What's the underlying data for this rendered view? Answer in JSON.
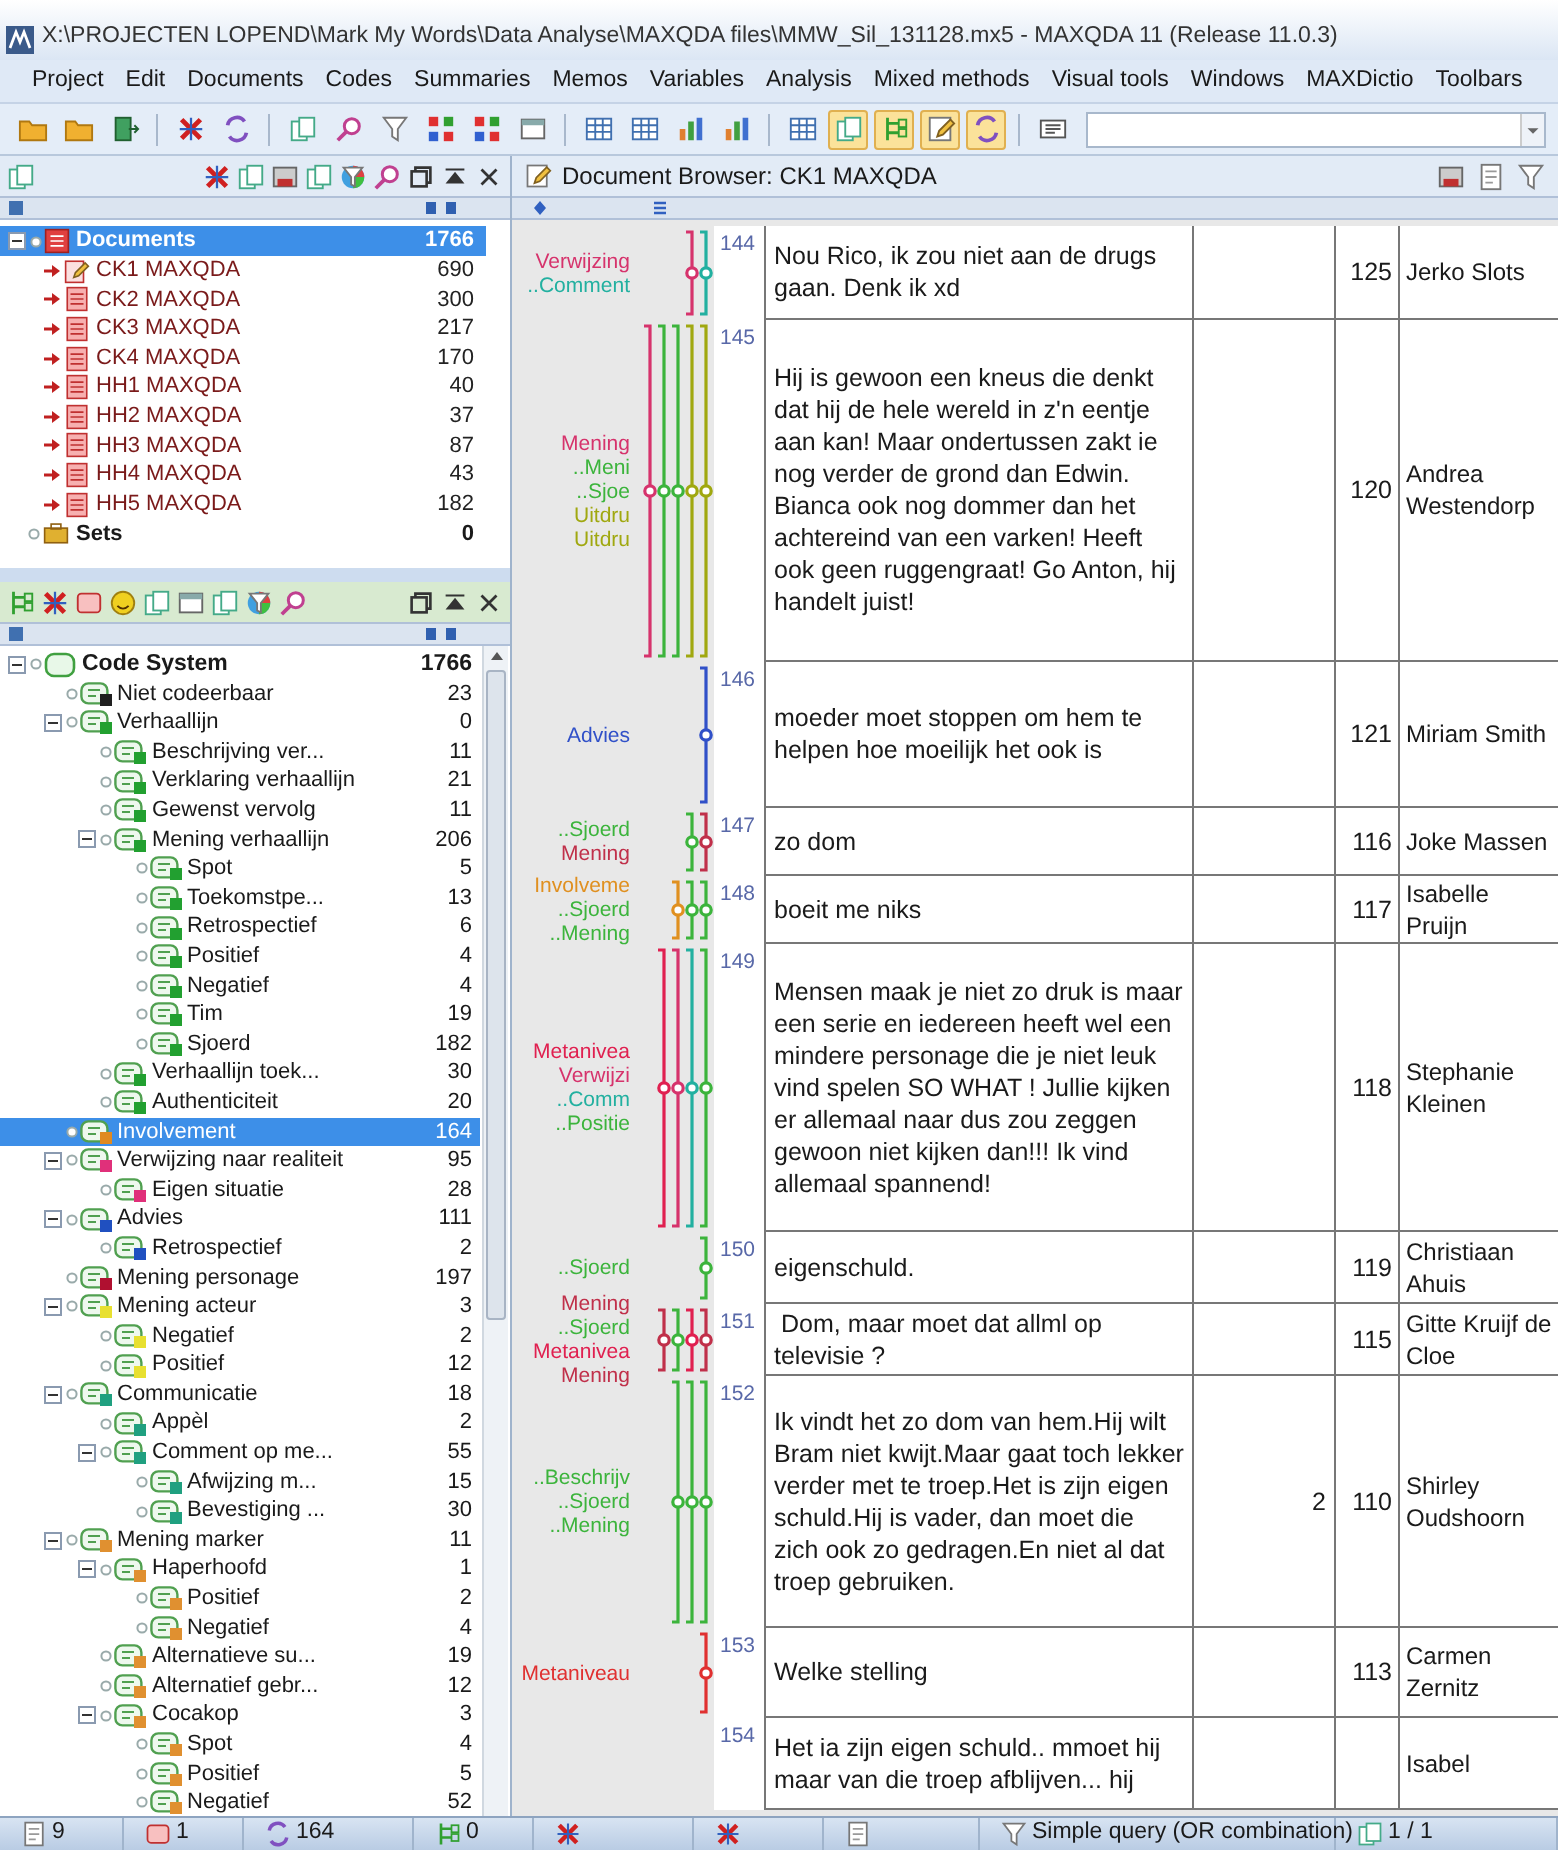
{
  "window": {
    "title": "X:\\PROJECTEN LOPEND\\Mark My Words\\Data Analyse\\MAXQDA files\\MMW_Sil_131128.mx5 - MAXQDA 11  (Release 11.0.3)"
  },
  "menu": [
    {
      "label": "Project"
    },
    {
      "label": "Edit"
    },
    {
      "label": "Documents"
    },
    {
      "label": "Codes"
    },
    {
      "label": "Summaries"
    },
    {
      "label": "Memos"
    },
    {
      "label": "Variables"
    },
    {
      "label": "Analysis"
    },
    {
      "label": "Mixed methods"
    },
    {
      "label": "Visual tools"
    },
    {
      "label": "Windows"
    },
    {
      "label": "MAXDictio"
    },
    {
      "label": "Toolbars"
    }
  ],
  "toolbar": [
    {
      "on": false
    },
    {
      "on": false
    },
    {
      "on": false
    },
    {
      "on": false
    },
    {
      "on": false
    },
    {
      "on": false
    },
    {
      "on": false
    },
    {
      "on": false
    },
    {
      "on": false
    },
    {
      "on": false
    },
    {
      "on": false
    },
    {
      "on": false
    },
    {
      "on": false
    },
    {
      "on": false
    },
    {
      "on": false
    },
    {
      "on": false
    },
    {
      "on": true
    },
    {
      "on": true
    },
    {
      "on": true
    },
    {
      "on": true
    },
    {
      "on": false
    }
  ],
  "document_system": {
    "root": {
      "label": "Documents",
      "count": "1766",
      "selected": true,
      "expanded": true
    },
    "documents": [
      {
        "label": "CK1 MAXQDA",
        "count": "690",
        "kind": "open"
      },
      {
        "label": "CK2 MAXQDA",
        "count": "300",
        "kind": "text"
      },
      {
        "label": "CK3 MAXQDA",
        "count": "217",
        "kind": "text"
      },
      {
        "label": "CK4 MAXQDA",
        "count": "170",
        "kind": "text"
      },
      {
        "label": "HH1 MAXQDA",
        "count": "40",
        "kind": "text"
      },
      {
        "label": "HH2 MAXQDA",
        "count": "37",
        "kind": "text"
      },
      {
        "label": "HH3 MAXQDA",
        "count": "87",
        "kind": "text"
      },
      {
        "label": "HH4 MAXQDA",
        "count": "43",
        "kind": "text"
      },
      {
        "label": "HH5 MAXQDA",
        "count": "182",
        "kind": "text"
      }
    ],
    "sets": {
      "label": "Sets",
      "count": "0"
    }
  },
  "code_system": {
    "label": "Code System",
    "count": "1766",
    "expanded": true,
    "children": [
      {
        "label": "Niet codeerbaar",
        "count": "23",
        "color": "#202020",
        "selected": false
      },
      {
        "label": "Verhaallijn",
        "count": "0",
        "color": "#22a030",
        "selected": false,
        "expanded": true,
        "children": [
          {
            "label": "Beschrijving ver...",
            "count": "11",
            "color": "#22a030",
            "selected": false
          },
          {
            "label": "Verklaring verhaallijn",
            "count": "21",
            "color": "#22a030",
            "selected": false
          },
          {
            "label": "Gewenst vervolg",
            "count": "11",
            "color": "#22a030",
            "selected": false
          },
          {
            "label": "Mening verhaallijn",
            "count": "206",
            "color": "#22a030",
            "selected": false,
            "expanded": true,
            "children": [
              {
                "label": "Spot",
                "count": "5",
                "color": "#22a030",
                "selected": false
              },
              {
                "label": "Toekomstpe...",
                "count": "13",
                "color": "#22a030",
                "selected": false
              },
              {
                "label": "Retrospectief",
                "count": "6",
                "color": "#22a030",
                "selected": false
              },
              {
                "label": "Positief",
                "count": "4",
                "color": "#22a030",
                "selected": false
              },
              {
                "label": "Negatief",
                "count": "4",
                "color": "#22a030",
                "selected": false
              },
              {
                "label": "Tim",
                "count": "19",
                "color": "#22a030",
                "selected": false
              },
              {
                "label": "Sjoerd",
                "count": "182",
                "color": "#22a030",
                "selected": false
              }
            ]
          },
          {
            "label": "Verhaallijn toek...",
            "count": "30",
            "color": "#22a030",
            "selected": false
          },
          {
            "label": "Authenticiteit",
            "count": "20",
            "color": "#22a030",
            "selected": false
          }
        ]
      },
      {
        "label": "Involvement",
        "count": "164",
        "color": "#e08a20",
        "selected": true
      },
      {
        "label": "Verwijzing naar realiteit",
        "count": "95",
        "color": "#e0307a",
        "selected": false,
        "expanded": true,
        "children": [
          {
            "label": "Eigen situatie",
            "count": "28",
            "color": "#e0307a",
            "selected": false
          }
        ]
      },
      {
        "label": "Advies",
        "count": "111",
        "color": "#2050c0",
        "selected": false,
        "expanded": true,
        "children": [
          {
            "label": "Retrospectief",
            "count": "2",
            "color": "#2050c0",
            "selected": false
          }
        ]
      },
      {
        "label": "Mening personage",
        "count": "197",
        "color": "#b01030",
        "selected": false
      },
      {
        "label": "Mening acteur",
        "count": "3",
        "color": "#e8e030",
        "selected": false,
        "expanded": true,
        "children": [
          {
            "label": "Negatief",
            "count": "2",
            "color": "#e8e030",
            "selected": false
          },
          {
            "label": "Positief",
            "count": "12",
            "color": "#e8e030",
            "selected": false
          }
        ]
      },
      {
        "label": "Communicatie",
        "count": "18",
        "color": "#20a080",
        "selected": false,
        "expanded": true,
        "children": [
          {
            "label": "Appèl",
            "count": "2",
            "color": "#20a080",
            "selected": false
          },
          {
            "label": "Comment op me...",
            "count": "55",
            "color": "#20a080",
            "selected": false,
            "expanded": true,
            "children": [
              {
                "label": "Afwijzing m...",
                "count": "15",
                "color": "#20a080",
                "selected": false
              },
              {
                "label": "Bevestiging ...",
                "count": "30",
                "color": "#20a080",
                "selected": false
              }
            ]
          }
        ]
      },
      {
        "label": "Mening marker",
        "count": "11",
        "color": "#e09030",
        "selected": false,
        "expanded": true,
        "children": [
          {
            "label": "Haperhoofd",
            "count": "1",
            "color": "#e09030",
            "selected": false,
            "expanded": true,
            "children": [
              {
                "label": "Positief",
                "count": "2",
                "color": "#e09030",
                "selected": false
              },
              {
                "label": "Negatief",
                "count": "4",
                "color": "#e09030",
                "selected": false
              }
            ]
          },
          {
            "label": "Alternatieve su...",
            "count": "19",
            "color": "#e09030",
            "selected": false
          },
          {
            "label": "Alternatief gebr...",
            "count": "12",
            "color": "#e09030",
            "selected": false
          },
          {
            "label": "Cocakop",
            "count": "3",
            "color": "#e09030",
            "selected": false,
            "expanded": true,
            "children": [
              {
                "label": "Spot",
                "count": "4",
                "color": "#e09030",
                "selected": false
              },
              {
                "label": "Positief",
                "count": "5",
                "color": "#e09030",
                "selected": false
              },
              {
                "label": "Negatief",
                "count": "52",
                "color": "#e09030",
                "selected": false
              }
            ]
          }
        ]
      }
    ]
  },
  "document_browser": {
    "title": "Document Browser: CK1 MAXQDA",
    "rows": [
      {
        "paragraph": "144",
        "codes": [
          {
            "label": "Verwijzing",
            "color": "#d6336c"
          },
          {
            "label": "..Comment",
            "color": "#22b0a0"
          }
        ],
        "text": "Nou Rico, ik zou niet aan de drugs gaan. Denk ik xd",
        "column_3": "125",
        "column_4": "Jerko Slots"
      },
      {
        "paragraph": "145",
        "codes": [
          {
            "label": "Mening",
            "color": "#d6336c"
          },
          {
            "label": "..Meni",
            "color": "#3cb43c"
          },
          {
            "label": "..Sjoe",
            "color": "#3cb43c"
          },
          {
            "label": "Uitdru",
            "color": "#a0a810"
          },
          {
            "label": "Uitdru",
            "color": "#a0a810"
          }
        ],
        "text": "Hij is gewoon een kneus die denkt dat hij de hele wereld in z'n eentje aan kan! Maar ondertussen zakt ie nog verder de grond dan Edwin. Bianca ook nog dommer dan het achtereind van een varken! Heeft ook geen ruggengraat! Go Anton, hij handelt juist!",
        "column_3": "120",
        "column_4": "Andrea Westendorp"
      },
      {
        "paragraph": "146",
        "codes": [
          {
            "label": "Advies",
            "color": "#3050c8"
          }
        ],
        "text": "moeder moet stoppen om hem te helpen hoe moeilijk het ook is",
        "column_3": "121",
        "column_4": "Miriam Smith"
      },
      {
        "paragraph": "147",
        "codes": [
          {
            "label": "..Sjoerd",
            "color": "#3cb43c"
          },
          {
            "label": "Mening",
            "color": "#c0304a"
          }
        ],
        "text": "zo dom",
        "column_3": "116",
        "column_4": "Joke Massen"
      },
      {
        "paragraph": "148",
        "codes": [
          {
            "label": "Involveme",
            "color": "#e09020"
          },
          {
            "label": "..Sjoerd",
            "color": "#3cb43c"
          },
          {
            "label": "..Mening",
            "color": "#3cb43c"
          }
        ],
        "text": "boeit me niks",
        "column_3": "117",
        "column_4": "Isabelle Pruijn"
      },
      {
        "paragraph": "149",
        "codes": [
          {
            "label": "Metanivea",
            "color": "#e02050"
          },
          {
            "label": "Verwijzi",
            "color": "#d6336c"
          },
          {
            "label": "..Comm",
            "color": "#22b0a0"
          },
          {
            "label": "..Positie",
            "color": "#3cb43c"
          }
        ],
        "text": "Mensen maak je niet zo druk is maar een serie en iedereen heeft wel een mindere personage die je niet leuk vind spelen SO WHAT ! Jullie kijken er allemaal naar dus zou zeggen gewoon niet kijken dan!!! Ik vind allemaal spannend!",
        "column_3": "118",
        "column_4": "Stephanie Kleinen"
      },
      {
        "paragraph": "150",
        "codes": [
          {
            "label": "..Sjoerd",
            "color": "#3cb43c"
          }
        ],
        "text": "eigenschuld.",
        "column_3": "119",
        "column_4": "Christiaan Ahuis"
      },
      {
        "paragraph": "151",
        "codes": [
          {
            "label": "Mening",
            "color": "#c0304a"
          },
          {
            "label": "..Sjoerd",
            "color": "#3cb43c"
          },
          {
            "label": "Metanivea",
            "color": "#e02050"
          },
          {
            "label": "Mening",
            "color": "#c0304a"
          }
        ],
        "text": " Dom, maar moet dat allml op televisie ?",
        "column_3": "115",
        "column_4": "Gitte Kruijf de Cloe"
      },
      {
        "paragraph": "152",
        "codes": [
          {
            "label": "..Beschrijv",
            "color": "#3cb43c"
          },
          {
            "label": "..Sjoerd",
            "color": "#3cb43c"
          },
          {
            "label": "..Mening",
            "color": "#3cb43c"
          }
        ],
        "text": "Ik vindt het zo dom van hem.Hij wilt Bram niet kwijt.Maar gaat toch lekker verder met te troep.Het is zijn eigen schuld.Hij is vader, dan moet die zich ook zo gedragen.En niet al dat troep gebruiken.",
        "column_2": "2",
        "column_3": "110",
        "column_4": "Shirley Oudshoorn"
      },
      {
        "paragraph": "153",
        "codes": [
          {
            "label": "Metaniveau",
            "color": "#e03030"
          }
        ],
        "text": "Welke stelling",
        "column_3": "113",
        "column_4": "Carmen Zernitz"
      },
      {
        "paragraph": "154",
        "codes": [],
        "text": "Het ia zijn eigen schuld.. mmoet hij maar van die troep afblijven... hij",
        "column_4": "Isabel"
      }
    ]
  },
  "status_bar": {
    "documents": "9",
    "memos": "1",
    "codes": "164",
    "variables": "0",
    "query": "Simple query (OR combination)",
    "page": "1 / 1"
  }
}
